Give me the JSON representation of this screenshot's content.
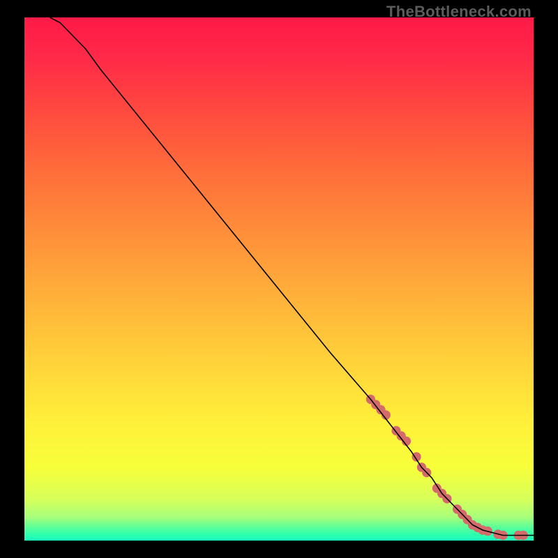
{
  "watermark": "TheBottleneck.com",
  "chart_data": {
    "type": "line",
    "title": "",
    "xlabel": "",
    "ylabel": "",
    "xlim": [
      0,
      100
    ],
    "ylim": [
      0,
      100
    ],
    "curve": {
      "name": "bottleneck-curve",
      "x": [
        5,
        7,
        9,
        12,
        15,
        20,
        30,
        40,
        50,
        60,
        68,
        72,
        76,
        78,
        80,
        82,
        84,
        86,
        88,
        90,
        92,
        94,
        96,
        98,
        100
      ],
      "y": [
        100,
        99,
        97,
        94,
        90,
        84,
        72,
        60,
        48,
        36,
        27,
        22,
        17,
        14,
        12,
        9,
        7,
        5,
        3,
        2,
        1.5,
        1,
        1,
        1,
        1
      ]
    },
    "highlight_points": {
      "name": "highlighted-range",
      "color": "#d46a6a",
      "x": [
        68,
        69,
        70,
        71,
        73,
        74,
        75,
        77,
        78,
        79,
        81,
        82,
        83,
        85,
        86,
        87,
        88,
        89,
        90,
        91,
        93,
        94,
        97,
        98
      ],
      "y": [
        27,
        26,
        25,
        24,
        21,
        20,
        19,
        16,
        14,
        13,
        10,
        9,
        8,
        6,
        5,
        4,
        3,
        2.5,
        2,
        1.8,
        1.2,
        1,
        1,
        1
      ]
    },
    "gradient_stops": [
      {
        "offset": 0.0,
        "color": "#ff1a47"
      },
      {
        "offset": 0.08,
        "color": "#ff2a48"
      },
      {
        "offset": 0.18,
        "color": "#ff4a3f"
      },
      {
        "offset": 0.3,
        "color": "#ff6f3a"
      },
      {
        "offset": 0.42,
        "color": "#ff913a"
      },
      {
        "offset": 0.55,
        "color": "#ffb53a"
      },
      {
        "offset": 0.68,
        "color": "#ffd83a"
      },
      {
        "offset": 0.78,
        "color": "#fff13a"
      },
      {
        "offset": 0.86,
        "color": "#f7ff3a"
      },
      {
        "offset": 0.92,
        "color": "#d8ff5a"
      },
      {
        "offset": 0.955,
        "color": "#a8ff7a"
      },
      {
        "offset": 0.975,
        "color": "#5aff9a"
      },
      {
        "offset": 0.99,
        "color": "#2affb0"
      },
      {
        "offset": 1.0,
        "color": "#1affc0"
      }
    ]
  }
}
